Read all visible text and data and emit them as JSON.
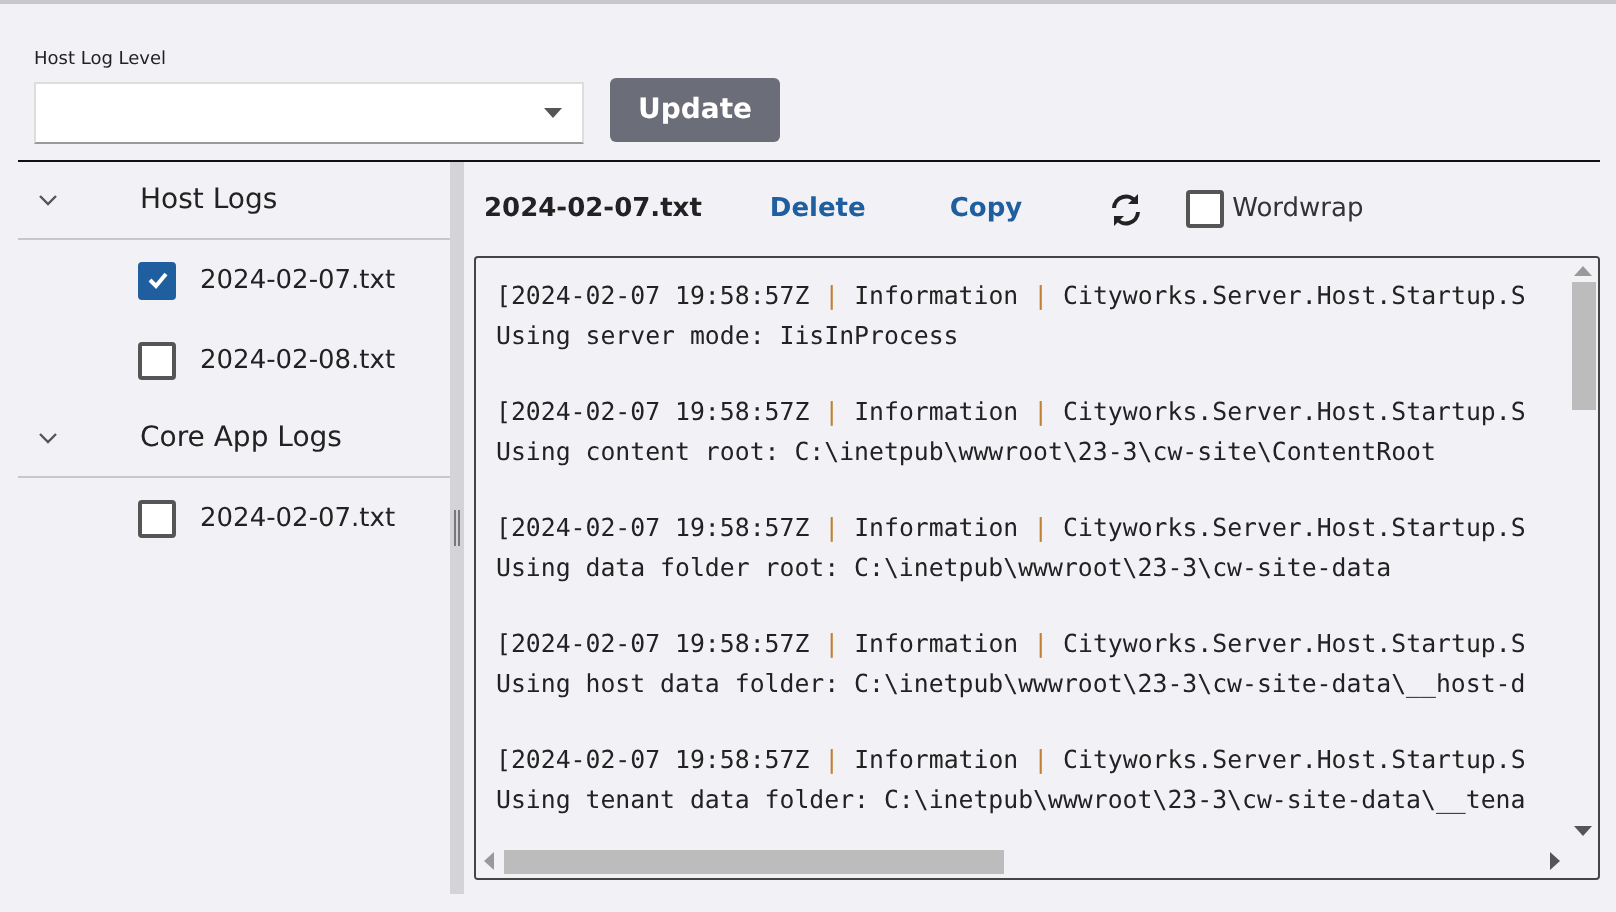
{
  "log_level": {
    "label": "Host Log Level"
  },
  "update_button": "Update",
  "groups": [
    {
      "title": "Host Logs",
      "expanded": true,
      "files": [
        {
          "name": "2024-02-07.txt",
          "checked": true
        },
        {
          "name": "2024-02-08.txt",
          "checked": false
        }
      ]
    },
    {
      "title": "Core App Logs",
      "expanded": true,
      "files": [
        {
          "name": "2024-02-07.txt",
          "checked": false
        }
      ]
    }
  ],
  "viewer": {
    "file_name": "2024-02-07.txt",
    "actions": [
      "Delete",
      "Copy"
    ],
    "wordwrap": {
      "label": "Wordwrap",
      "checked": false
    },
    "separator": "|",
    "entries": [
      {
        "header": [
          "[2024-02-07 19:58:57Z",
          "Information",
          "Cityworks.Server.Host.Startup.S"
        ],
        "message": "Using server mode: IisInProcess"
      },
      {
        "header": [
          "[2024-02-07 19:58:57Z",
          "Information",
          "Cityworks.Server.Host.Startup.S"
        ],
        "message": "Using content root: C:\\inetpub\\wwwroot\\23-3\\cw-site\\ContentRoot"
      },
      {
        "header": [
          "[2024-02-07 19:58:57Z",
          "Information",
          "Cityworks.Server.Host.Startup.S"
        ],
        "message": "Using data folder root: C:\\inetpub\\wwwroot\\23-3\\cw-site-data"
      },
      {
        "header": [
          "[2024-02-07 19:58:57Z",
          "Information",
          "Cityworks.Server.Host.Startup.S"
        ],
        "message": "Using host data folder: C:\\inetpub\\wwwroot\\23-3\\cw-site-data\\__host-d"
      },
      {
        "header": [
          "[2024-02-07 19:58:57Z",
          "Information",
          "Cityworks.Server.Host.Startup.S"
        ],
        "message": "Using tenant data folder: C:\\inetpub\\wwwroot\\23-3\\cw-site-data\\__tena"
      }
    ]
  }
}
